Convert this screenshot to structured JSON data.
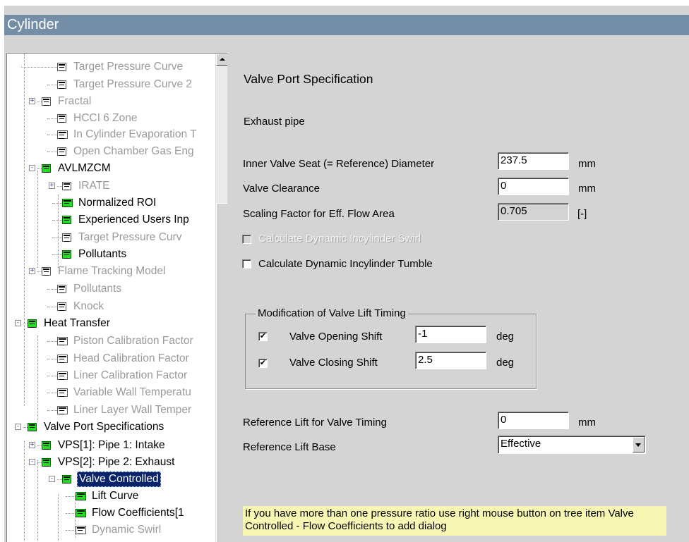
{
  "window": {
    "title": "Cylinder"
  },
  "tree": {
    "items": [
      {
        "label": "Target Pressure Curve",
        "state": "gray",
        "icon": "sheet-icon"
      },
      {
        "label": "Target Pressure Curve 2",
        "state": "gray",
        "icon": "sheet-icon"
      },
      {
        "label": "Fractal",
        "state": "gray",
        "icon": "sheet-icon",
        "expander": "+"
      },
      {
        "label": "HCCI 6 Zone",
        "state": "gray",
        "icon": "sheet-icon"
      },
      {
        "label": "In Cylinder Evaporation T",
        "state": "gray",
        "icon": "table-icon"
      },
      {
        "label": "Open Chamber Gas Eng",
        "state": "gray",
        "icon": "sheet-icon"
      },
      {
        "label": "AVLMZCM",
        "state": "active",
        "icon": "green-sheet-icon",
        "expander": "-"
      },
      {
        "label": "IRATE",
        "state": "gray",
        "icon": "sheet-icon",
        "expander": "+"
      },
      {
        "label": "Normalized ROI",
        "state": "active",
        "icon": "green-table-icon"
      },
      {
        "label": "Experienced Users Inp",
        "state": "active",
        "icon": "green-sheet-icon"
      },
      {
        "label": "Target Pressure Curv",
        "state": "gray",
        "icon": "sheet-icon"
      },
      {
        "label": "Pollutants",
        "state": "active",
        "icon": "green-sheet-icon"
      },
      {
        "label": "Flame Tracking Model",
        "state": "gray",
        "icon": "sheet-icon",
        "expander": "+"
      },
      {
        "label": "Pollutants",
        "state": "gray",
        "icon": "sheet-icon"
      },
      {
        "label": "Knock",
        "state": "gray",
        "icon": "sheet-icon"
      },
      {
        "label": "Heat Transfer",
        "state": "active",
        "icon": "green-sheet-icon",
        "expander": "-"
      },
      {
        "label": "Piston Calibration Factor",
        "state": "gray",
        "icon": "table-icon"
      },
      {
        "label": "Head Calibration Factor",
        "state": "gray",
        "icon": "table-icon"
      },
      {
        "label": "Liner Calibration Factor",
        "state": "gray",
        "icon": "table-icon"
      },
      {
        "label": "Variable Wall Temperatu",
        "state": "gray",
        "icon": "table-icon"
      },
      {
        "label": "Liner Layer Wall Temper",
        "state": "gray",
        "icon": "table-icon"
      },
      {
        "label": "Valve Port Specifications",
        "state": "active",
        "icon": "green-sheet-icon",
        "expander": "-"
      },
      {
        "label": "VPS[1]: Pipe 1: Intake",
        "state": "active",
        "icon": "green-sheet-icon",
        "expander": "+"
      },
      {
        "label": "VPS[2]: Pipe 2: Exhaust",
        "state": "active",
        "icon": "green-sheet-icon",
        "expander": "-"
      },
      {
        "label": "Valve Controlled",
        "state": "selected",
        "icon": "green-sheet-icon",
        "expander": "-"
      },
      {
        "label": "Lift Curve",
        "state": "active",
        "icon": "green-table-icon"
      },
      {
        "label": "Flow Coefficients[1",
        "state": "active",
        "icon": "green-table-icon"
      },
      {
        "label": "Dynamic Swirl",
        "state": "gray",
        "icon": "table-icon"
      }
    ]
  },
  "form": {
    "heading": "Valve Port Specification",
    "subheading": "Exhaust pipe",
    "inner_diameter": {
      "label": "Inner Valve Seat (= Reference) Diameter",
      "value": "237.5",
      "unit": "mm"
    },
    "valve_clearance": {
      "label": "Valve Clearance",
      "value": "0",
      "unit": "mm"
    },
    "scaling_factor": {
      "label": "Scaling Factor for Eff. Flow Area",
      "value": "0.705",
      "unit": "[-]"
    },
    "dynamic_swirl": {
      "label": "Calculate Dynamic Incylinder Swirl",
      "checked": false,
      "enabled": false
    },
    "dynamic_tumble": {
      "label": "Calculate Dynamic Incylinder Tumble",
      "checked": false,
      "enabled": true
    },
    "lift_timing_group": {
      "title": "Modification of Valve Lift Timing",
      "opening_shift": {
        "label": "Valve Opening Shift",
        "value": "-1",
        "unit": "deg",
        "checked": true,
        "mark": "✔"
      },
      "closing_shift": {
        "label": "Valve Closing Shift",
        "value": "2.5",
        "unit": "deg",
        "checked": true,
        "mark": "✔"
      }
    },
    "reference_lift": {
      "label": "Reference Lift for Valve Timing",
      "value": "0",
      "unit": "mm"
    },
    "reference_lift_base": {
      "label": "Reference Lift Base",
      "value": "Effective"
    },
    "hint": "If you have more than one pressure ratio use right mouse button on tree item Valve Controlled - Flow Coefficients to add dialog"
  }
}
